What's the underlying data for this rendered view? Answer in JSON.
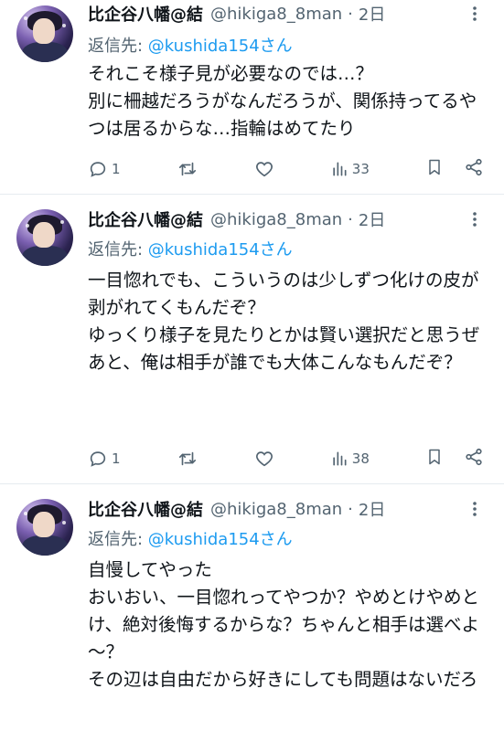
{
  "tweets": [
    {
      "name": "比企谷八幡@結",
      "handle": "@hikiga8_8man",
      "separator": "·",
      "time": "2日",
      "reply_prefix": "返信先: ",
      "reply_to": "@kushida154さん",
      "text": "それこそ様子見が必要なのでは…？\n別に柵越だろうがなんだろうが、関係持ってるやつは居るからな…指輪はめてたり",
      "replies": "1",
      "retweets": "",
      "likes": "",
      "views": "33"
    },
    {
      "name": "比企谷八幡@結",
      "handle": "@hikiga8_8man",
      "separator": "·",
      "time": "2日",
      "reply_prefix": "返信先: ",
      "reply_to": "@kushida154さん",
      "text": "一目惚れでも、こういうのは少しずつ化けの皮が剥がれてくもんだぞ？\nゆっくり様子を見たりとかは賢い選択だと思うぜ\nあと、俺は相手が誰でも大体こんなもんだぞ？",
      "replies": "1",
      "retweets": "",
      "likes": "",
      "views": "38"
    },
    {
      "name": "比企谷八幡@結",
      "handle": "@hikiga8_8man",
      "separator": "·",
      "time": "2日",
      "reply_prefix": "返信先: ",
      "reply_to": "@kushida154さん",
      "text": "自慢してやった\nおいおい、一目惚れってやつか？やめとけやめとけ、絶対後悔するからな？ちゃんと相手は選べよ～？\nその辺は自由だから好きにしても問題はないだろ"
    }
  ],
  "icons": [
    "more-icon",
    "reply-icon",
    "retweet-icon",
    "like-icon",
    "views-icon",
    "bookmark-icon",
    "share-icon"
  ],
  "colors": {
    "accent": "#1d9bf0",
    "muted": "#536471",
    "text": "#0f1419",
    "divider": "#e6ecf0"
  }
}
